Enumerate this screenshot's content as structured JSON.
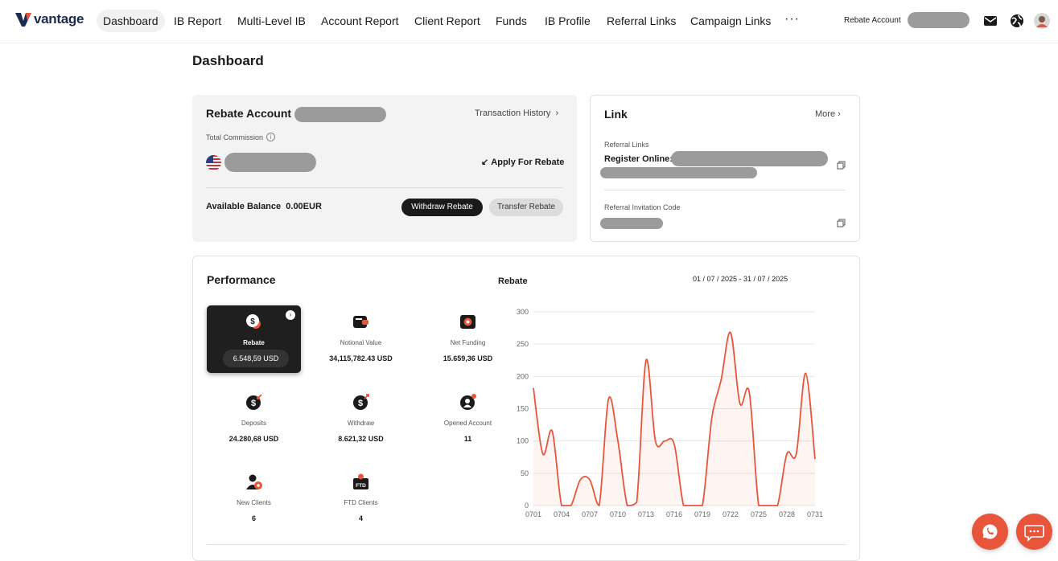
{
  "brand": {
    "name": "vantage",
    "accent": "#e8553a",
    "dark": "#1a1a1a"
  },
  "nav": {
    "items": [
      {
        "label": "Dashboard",
        "active": true
      },
      {
        "label": "IB Report"
      },
      {
        "label": "Multi-Level IB"
      },
      {
        "label": "Account Report"
      },
      {
        "label": "Client Report"
      },
      {
        "label": "Funds"
      },
      {
        "label": "IB Profile"
      },
      {
        "label": "Referral Links"
      },
      {
        "label": "Campaign Links"
      }
    ],
    "more": "···",
    "rebate_account_label": "Rebate Account",
    "icons": [
      "mail-icon",
      "globe-icon",
      "avatar"
    ]
  },
  "page": {
    "title": "Dashboard"
  },
  "rebate_card": {
    "title": "Rebate Account",
    "transaction_history": "Transaction History",
    "total_commission": "Total Commission",
    "apply_label": "Apply For Rebate",
    "available_label": "Available Balance",
    "available_value": "0.00EUR",
    "withdraw_button": "Withdraw Rebate",
    "transfer_button": "Transfer Rebate"
  },
  "link_card": {
    "title": "Link",
    "more": "More",
    "referral_links_label": "Referral Links",
    "register_label": "Register Online:",
    "invitation_code_label": "Referral Invitation Code"
  },
  "performance": {
    "title": "Performance",
    "chart_title": "Rebate",
    "date_range": "01 / 07 / 2025 - 31 / 07 / 2025",
    "stats": [
      {
        "label": "Rebate",
        "value": "6.548,59 USD",
        "icon": "dollar-coin-icon",
        "active": true
      },
      {
        "label": "Notional Value",
        "value": "34,115,782.43 USD",
        "icon": "wallet-icon"
      },
      {
        "label": "Net Funding",
        "value": "15.659,36 USD",
        "icon": "safe-icon"
      },
      {
        "label": "Deposits",
        "value": "24.280,68 USD",
        "icon": "deposit-icon"
      },
      {
        "label": "Withdraw",
        "value": "8.621,32 USD",
        "icon": "withdraw-icon"
      },
      {
        "label": "Opened Account",
        "value": "11",
        "icon": "opened-account-icon"
      },
      {
        "label": "New Clients",
        "value": "6",
        "icon": "new-client-icon"
      },
      {
        "label": "FTD Clients",
        "value": "4",
        "icon": "ftd-icon"
      }
    ]
  },
  "chart_data": {
    "type": "line",
    "title": "Rebate",
    "x": [
      "0701",
      "0702",
      "0703",
      "0704",
      "0705",
      "0706",
      "0707",
      "0708",
      "0709",
      "0710",
      "0711",
      "0712",
      "0713",
      "0714",
      "0715",
      "0716",
      "0717",
      "0718",
      "0719",
      "0720",
      "0721",
      "0722",
      "0723",
      "0724",
      "0725",
      "0726",
      "0727",
      "0728",
      "0729",
      "0730",
      "0731"
    ],
    "xticks": [
      "0701",
      "0704",
      "0707",
      "0710",
      "0713",
      "0716",
      "0719",
      "0722",
      "0725",
      "0728",
      "0731"
    ],
    "series": [
      {
        "values": [
          182,
          80,
          115,
          0,
          0,
          40,
          40,
          0,
          165,
          100,
          0,
          5,
          225,
          100,
          100,
          95,
          0,
          0,
          0,
          135,
          195,
          268,
          158,
          175,
          0,
          0,
          0,
          80,
          80,
          205,
          72
        ]
      }
    ],
    "ylim": [
      0,
      300
    ],
    "yticks": [
      0,
      50,
      100,
      150,
      200,
      250,
      300
    ],
    "grid": true,
    "line_color": "#e8553a"
  },
  "floating": {
    "icons": [
      "whatsapp-icon",
      "chat-icon"
    ]
  }
}
